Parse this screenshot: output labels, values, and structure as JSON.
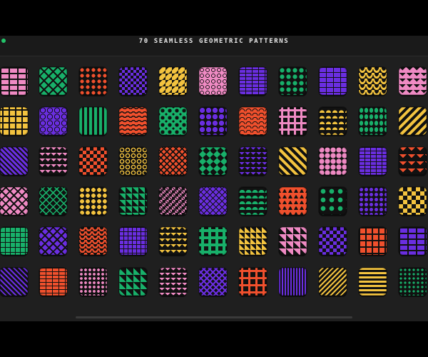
{
  "header": {
    "title": "70 SEAMLESS GEOMETRIC PATTERNS"
  },
  "colors": {
    "pink": "#ef8ac3",
    "green": "#18b06a",
    "red": "#f0502d",
    "purple": "#6a2ee0",
    "yellow": "#f3c33f",
    "dark": "#111111",
    "panel": "#1f1f1f"
  },
  "patterns": [
    [
      "pink-bricks",
      "green-diamonds",
      "red-dots",
      "purple-checker",
      "yellow-triangles",
      "pink-circles",
      "purple-stripes",
      "green-dots",
      "purple-bricks",
      "yellow-waves",
      "pink-chevrons"
    ],
    [
      "yellow-crosses",
      "purple-hexagons",
      "green-vertical-stripes",
      "red-waves",
      "green-quatrefoil",
      "purple-circles",
      "red-scales",
      "pink-crosses",
      "yellow-half-circles",
      "green-leaves",
      "yellow-diagonal-stripes"
    ],
    [
      "purple-diagonal-stripes",
      "pink-zigzag",
      "red-checker",
      "yellow-rings",
      "red-diamonds",
      "green-diagonal-checker",
      "purple-zigzag",
      "yellow-hazard-stripes",
      "pink-hexagons",
      "purple-bricks-2",
      "red-zigzag"
    ],
    [
      "pink-diamonds",
      "green-diamond-grid",
      "yellow-dots",
      "green-triangles",
      "pink-pinwheel",
      "purple-grid-diamonds",
      "green-scales",
      "red-triangles",
      "green-stars",
      "purple-dots",
      "yellow-checker"
    ],
    [
      "green-cross-grid",
      "purple-diamonds",
      "red-waves-2",
      "purple-grid",
      "yellow-arrows",
      "green-crosses",
      "yellow-triangle-rows",
      "pink-triangles",
      "purple-checker-2",
      "red-squares",
      "purple-bricks-3"
    ],
    [
      "purple-diagonal-lines",
      "red-bricks",
      "pink-dots",
      "pink-triangle-rows",
      "purple-chevrons",
      "purple-diamond-rows",
      "red-crosses",
      "purple-vertical-lines",
      "yellow-diagonal-lines",
      "yellow-horizontal-lines",
      "green-dot-grid"
    ]
  ]
}
